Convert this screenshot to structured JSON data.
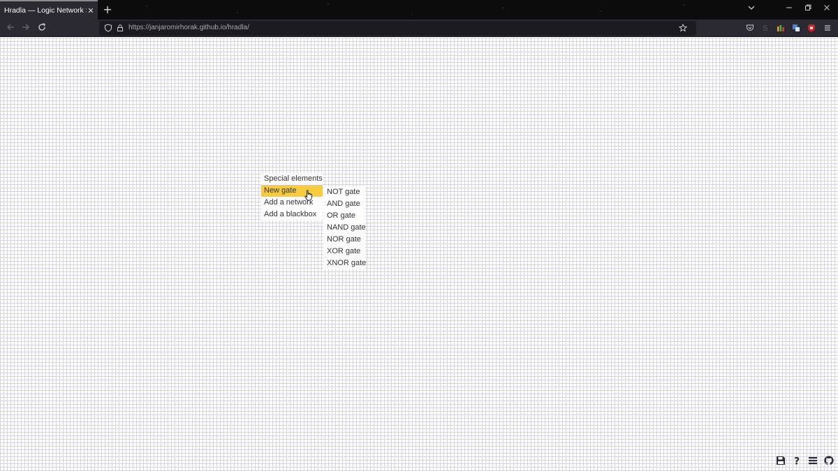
{
  "browser": {
    "tab_title": "Hradla — Logic Network Simulator",
    "tab_close": "✕",
    "new_tab": "+",
    "url": "https://janjaromirhorak.github.io/hradla/"
  },
  "menu": {
    "items": [
      {
        "label": "Special elements"
      },
      {
        "label": "New gate",
        "active": true
      },
      {
        "label": "Add a network"
      },
      {
        "label": "Add a blackbox"
      }
    ]
  },
  "submenu": {
    "items": [
      {
        "label": "NOT gate"
      },
      {
        "label": "AND gate"
      },
      {
        "label": "OR gate"
      },
      {
        "label": "NAND gate"
      },
      {
        "label": "NOR gate"
      },
      {
        "label": "XOR gate"
      },
      {
        "label": "XNOR gate"
      }
    ]
  },
  "toolbar": {
    "icons": [
      "save-icon",
      "help-icon",
      "menu-icon",
      "github-icon"
    ],
    "help_glyph": "?"
  },
  "colors": {
    "menu_active": "#f5cc40",
    "grid": "#d4d3e4",
    "chrome_bg": "#2b2a33"
  }
}
